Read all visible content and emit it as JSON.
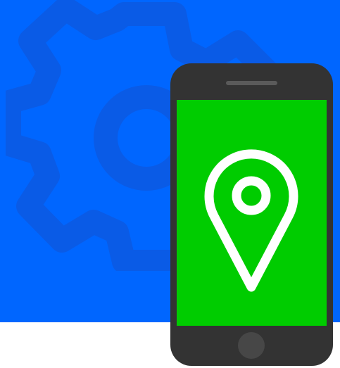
{
  "colors": {
    "background": "#FFFFFF",
    "panel": "#0066FF",
    "gear": "#0A5BE6",
    "phone_body": "#333333",
    "screen": "#00CC00",
    "pin": "#FFFFFF",
    "speaker": "#5A5A5A",
    "home_button": "#474747"
  },
  "icons": {
    "background": "gear-icon",
    "device": "smartphone-icon",
    "screen_symbol": "location-pin-icon"
  }
}
